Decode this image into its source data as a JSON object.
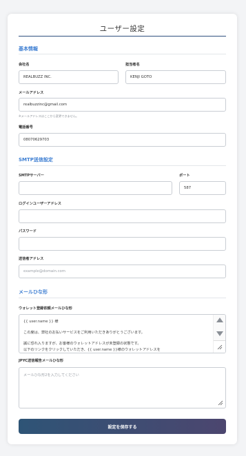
{
  "page": {
    "title": "ユーザー設定"
  },
  "basic": {
    "section_title": "基本情報",
    "company": {
      "label": "会社名",
      "value": "REALBUZZ INC."
    },
    "person": {
      "label": "担当者名",
      "value": "KENJI GOTO"
    },
    "email": {
      "label": "メールアドレス",
      "value": "realbuzzinc@gmail.com",
      "hint": "※メールアドレスはここから変更できません。"
    },
    "phone": {
      "label": "電話番号",
      "value": "08070629703"
    }
  },
  "smtp": {
    "section_title": "SMTP送信設定",
    "server": {
      "label": "SMTPサーバー",
      "value": ""
    },
    "port": {
      "label": "ポート",
      "value": "587"
    },
    "login": {
      "label": "ログインユーザーアドレス",
      "value": ""
    },
    "password": {
      "label": "パスワード",
      "value": ""
    },
    "sender": {
      "label": "送信者アドレス",
      "placeholder": "example@domain.com"
    }
  },
  "templates": {
    "section_title": "メールひな形",
    "wallet": {
      "label": "ウォレット登録依頼メールひな形",
      "lines": [
        "{{ user.name }} 様",
        "",
        "この度は、弊社のお払いサービスをご利用いただきありがとうございます。",
        "",
        "誠に恐れ入りますが、お客様のウォレットアドレスが未登録の状態です。",
        "以下のリンクをクリックしていただき、{{ user.name }}様のウォレットアドレスを"
      ]
    },
    "jpyc": {
      "label": "JPYC送信報告メールひな形",
      "placeholder": "メールひな形2を入力してください"
    }
  },
  "actions": {
    "save_label": "設定を保存する"
  },
  "colors": {
    "accent": "#3d7ed2",
    "title_line": "#2f4f7f",
    "button_start": "#2e5476",
    "button_end": "#4c466f"
  }
}
